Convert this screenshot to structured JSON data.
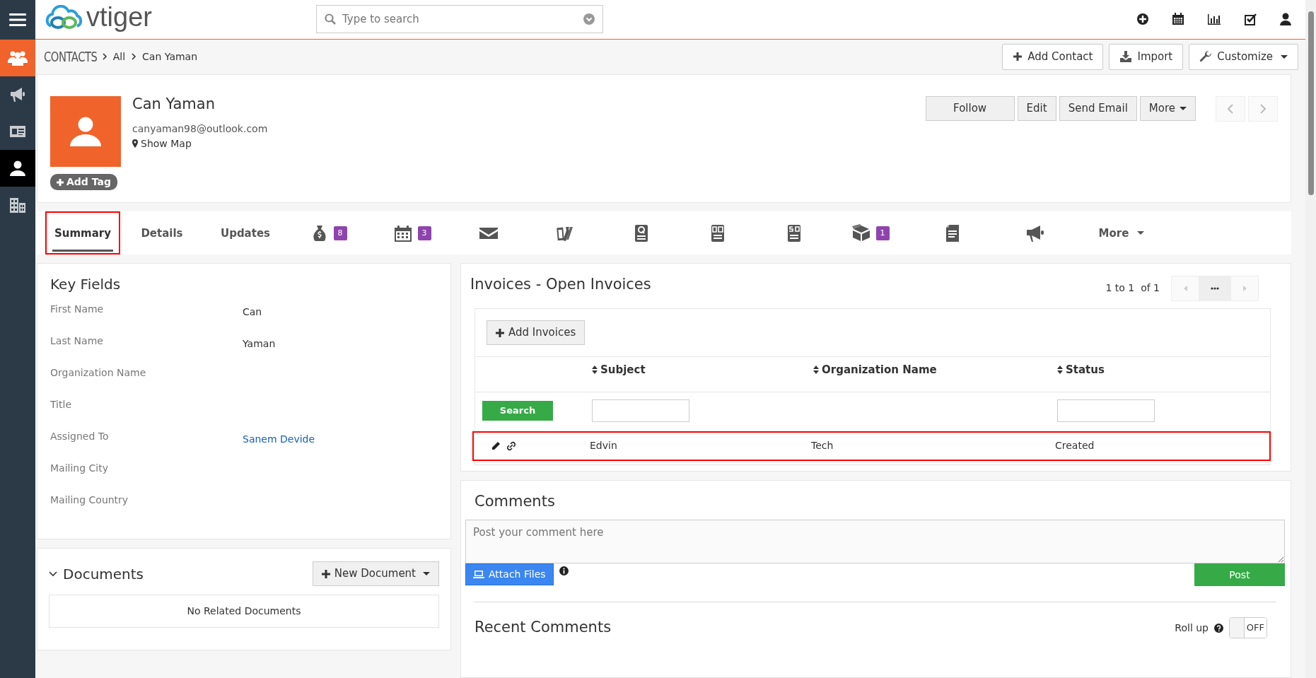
{
  "sidebar": {
    "items": [
      {
        "kind": "app",
        "selected": false
      },
      {
        "kind": "module",
        "selected": false
      },
      {
        "kind": "module",
        "selected": false
      },
      {
        "kind": "module",
        "selected": true
      },
      {
        "kind": "module",
        "selected": false
      }
    ]
  },
  "topbar": {
    "logo": "vtiger",
    "search": {
      "placeholder": "Type to search"
    }
  },
  "breadcrumb": {
    "module": "CONTACTS",
    "items": [
      "All",
      "Can Yaman"
    ],
    "actions": [
      {
        "label": "Add Contact",
        "caret": false
      },
      {
        "label": "Import",
        "caret": false
      },
      {
        "label": "Customize",
        "caret": true
      }
    ]
  },
  "record": {
    "name": "Can Yaman",
    "email": "canyaman98@outlook.com",
    "map_link": "Show Map",
    "tag_button": "Add Tag",
    "actions": [
      {
        "label": "Follow",
        "caret": false
      },
      {
        "label": "Edit",
        "caret": false
      },
      {
        "label": "Send Email",
        "caret": false
      },
      {
        "label": "More",
        "caret": true
      }
    ]
  },
  "tabs": [
    {
      "kind": "text",
      "label": "Summary",
      "selected": true,
      "highlighted": true
    },
    {
      "kind": "text",
      "label": "Details",
      "selected": false,
      "highlighted": false
    },
    {
      "kind": "text",
      "label": "Updates",
      "selected": false,
      "highlighted": false
    },
    {
      "kind": "icon",
      "badge": "8",
      "selected": false,
      "highlighted": false
    },
    {
      "kind": "icon",
      "badge": "3",
      "selected": false,
      "highlighted": false
    },
    {
      "kind": "icon",
      "selected": false,
      "highlighted": false
    },
    {
      "kind": "icon",
      "selected": false,
      "highlighted": false
    },
    {
      "kind": "icon",
      "selected": false,
      "highlighted": false
    },
    {
      "kind": "icon",
      "selected": false,
      "highlighted": false
    },
    {
      "kind": "icon",
      "selected": false,
      "highlighted": false
    },
    {
      "kind": "icon",
      "badge": "1",
      "selected": false,
      "highlighted": false
    },
    {
      "kind": "icon",
      "selected": false,
      "highlighted": false
    },
    {
      "kind": "icon",
      "selected": false,
      "highlighted": false
    },
    {
      "kind": "more",
      "label": "More",
      "selected": false,
      "highlighted": false
    }
  ],
  "key_fields": {
    "title": "Key Fields",
    "fields": [
      {
        "label": "First Name",
        "value": "Can",
        "kind": "text"
      },
      {
        "label": "Last Name",
        "value": "Yaman",
        "kind": "text"
      },
      {
        "label": "Organization Name"
      },
      {
        "label": "Title"
      },
      {
        "label": "Assigned To",
        "value": "Sanem Devide",
        "kind": "link"
      },
      {
        "label": "Mailing City"
      },
      {
        "label": "Mailing Country"
      }
    ]
  },
  "documents": {
    "title": "Documents",
    "expanded": true,
    "button": "New Document",
    "empty_text": "No Related Documents"
  },
  "invoices": {
    "title": "Invoices - Open Invoices",
    "pagination": "1 to 1  of 1",
    "add_button": "Add Invoices",
    "search_button": "Search",
    "columns": [
      {
        "label": "Subject",
        "filter": true
      },
      {
        "label": "Organization Name",
        "filter": false
      },
      {
        "label": "Status",
        "filter": true
      }
    ],
    "rows": [
      {
        "cells": [
          "Edvin",
          "Tech",
          "Created"
        ],
        "highlighted": true
      }
    ]
  },
  "comments": {
    "title": "Comments",
    "placeholder": "Post your comment here",
    "attach_button": "Attach Files",
    "post_button": "Post",
    "recent_title": "Recent Comments",
    "rollup": {
      "label": "Roll up",
      "on": false,
      "state_label": "OFF"
    }
  }
}
